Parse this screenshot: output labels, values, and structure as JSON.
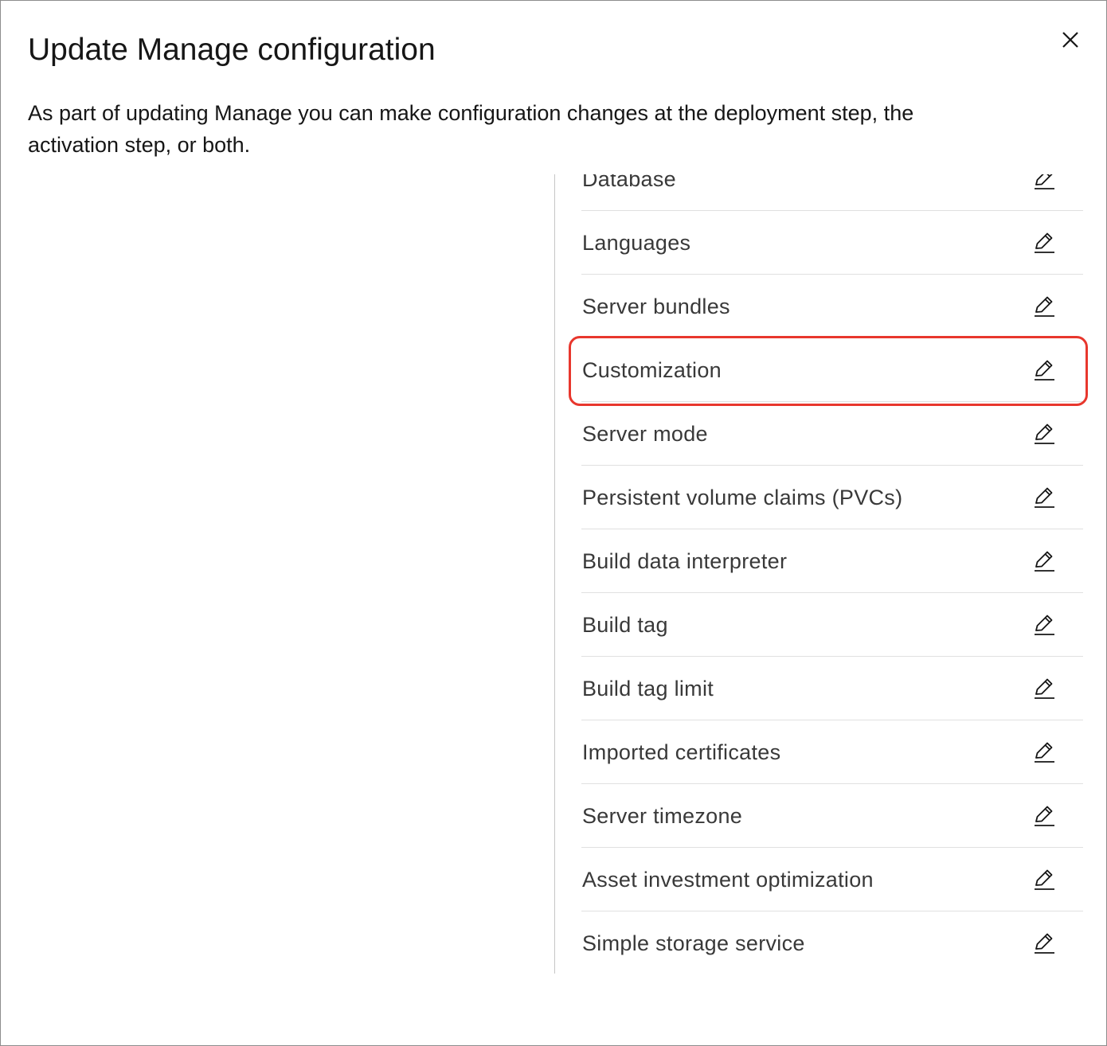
{
  "modal": {
    "title": "Update Manage configuration",
    "description": "As part of updating Manage you can make configuration changes at the deployment step, the activation step, or both.",
    "close_icon": "close-icon"
  },
  "config_list": {
    "edit_icon": "edit-icon",
    "items": [
      {
        "label": "Database"
      },
      {
        "label": "Languages"
      },
      {
        "label": "Server bundles"
      },
      {
        "label": "Customization",
        "highlighted": true
      },
      {
        "label": "Server mode"
      },
      {
        "label": "Persistent volume claims (PVCs)"
      },
      {
        "label": "Build data interpreter"
      },
      {
        "label": "Build tag"
      },
      {
        "label": "Build tag limit"
      },
      {
        "label": "Imported certificates"
      },
      {
        "label": "Server timezone"
      },
      {
        "label": "Asset investment optimization"
      },
      {
        "label": "Simple storage service"
      }
    ]
  },
  "colors": {
    "highlight_border": "#e8372d",
    "text_primary": "#161616",
    "text_secondary": "#393939",
    "row_divider": "#e0e0e0"
  }
}
